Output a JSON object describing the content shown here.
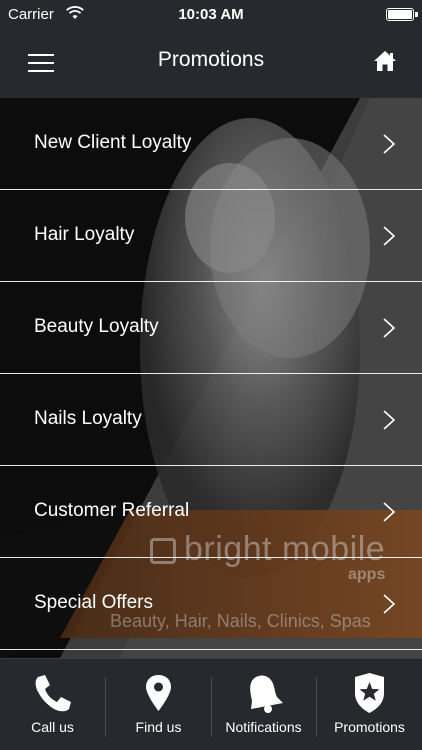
{
  "status_bar": {
    "carrier": "Carrier",
    "time": "10:03 AM"
  },
  "nav": {
    "title": "Promotions"
  },
  "promotions": [
    {
      "label": "New Client Loyalty"
    },
    {
      "label": "Hair Loyalty"
    },
    {
      "label": "Beauty Loyalty"
    },
    {
      "label": "Nails Loyalty"
    },
    {
      "label": "Customer Referral"
    },
    {
      "label": "Special Offers"
    }
  ],
  "watermark": {
    "brand": "bright mobile",
    "sub": "apps",
    "tagline": "Beauty, Hair, Nails, Clinics, Spas"
  },
  "tabs": [
    {
      "label": "Call us",
      "icon": "phone-icon"
    },
    {
      "label": "Find us",
      "icon": "map-pin-icon"
    },
    {
      "label": "Notifications",
      "icon": "bell-icon"
    },
    {
      "label": "Promotions",
      "icon": "star-shield-icon"
    }
  ],
  "colors": {
    "bar_background": "#26292d",
    "accent_orange": "#6b3d1f"
  }
}
